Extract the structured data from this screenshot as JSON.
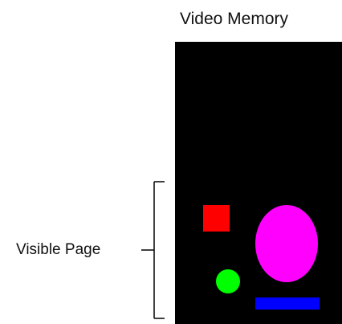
{
  "diagram": {
    "title": "Video Memory",
    "bracket_label": "Visible Page",
    "colors": {
      "memory_background": "#000000",
      "bracket": "#111111",
      "red_square": "#ff0000",
      "magenta_ellipse": "#ff00ff",
      "green_circle": "#00ff00",
      "blue_bar": "#0000ff"
    },
    "shapes": [
      "red-square",
      "magenta-ellipse",
      "green-circle",
      "blue-bar"
    ]
  }
}
